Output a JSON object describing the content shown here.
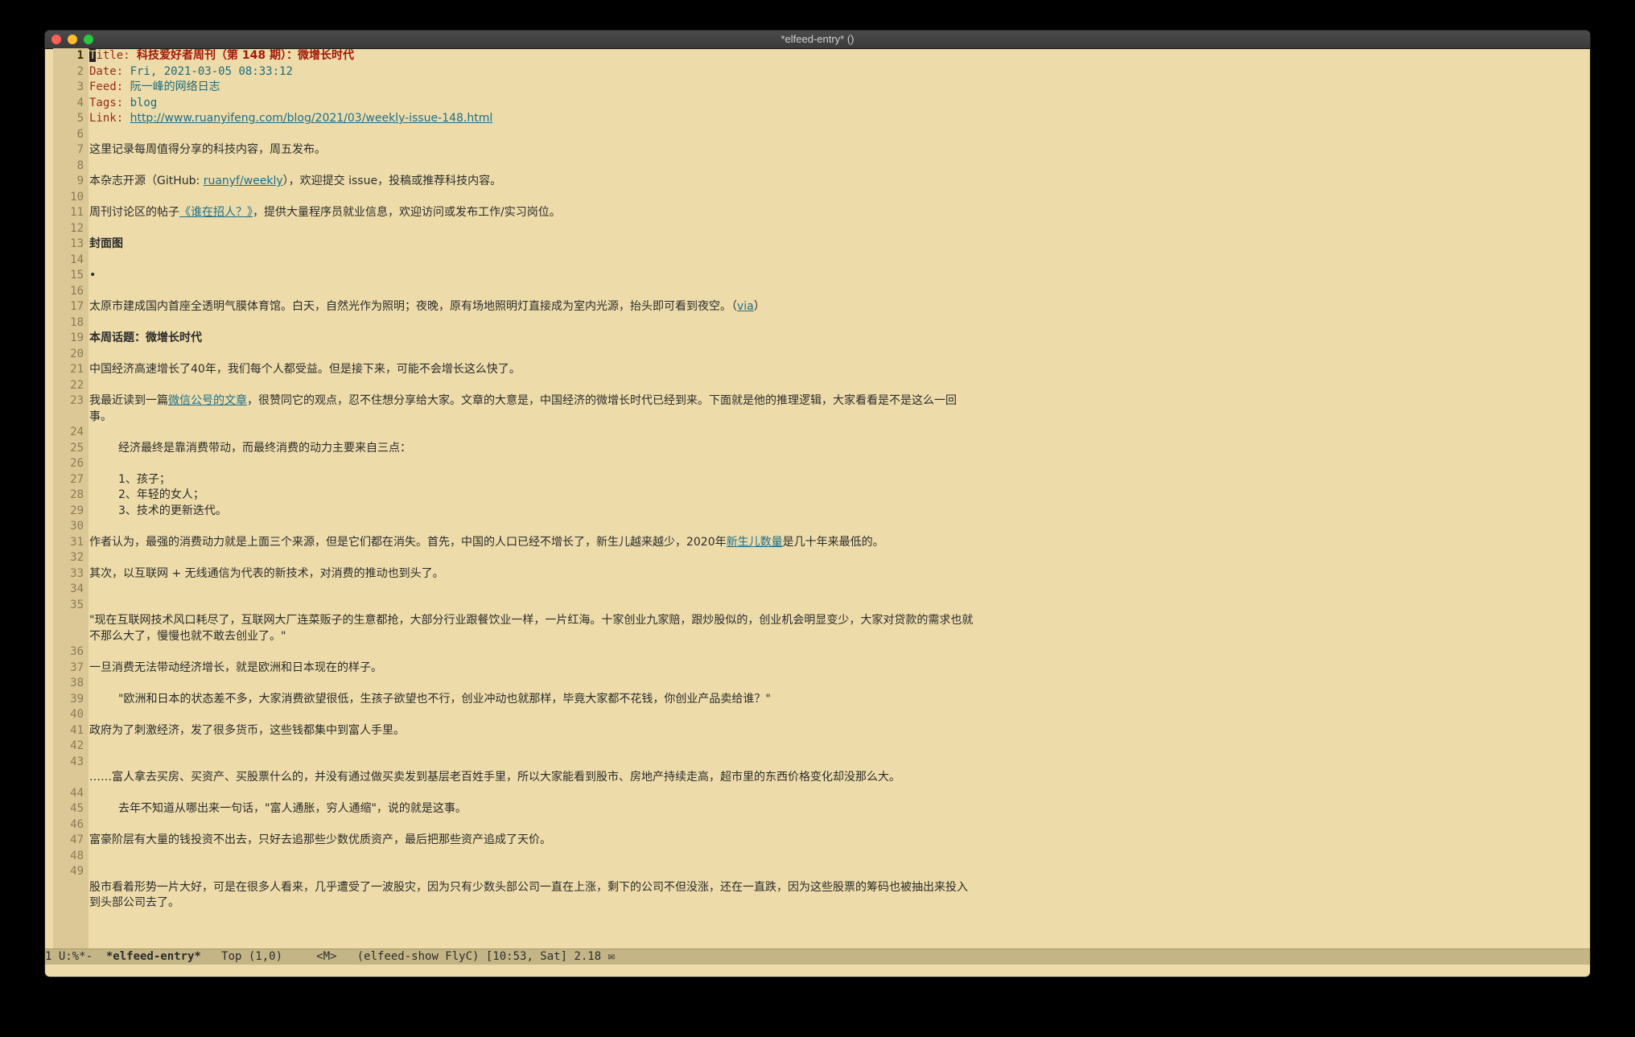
{
  "window": {
    "title": "*elfeed-entry* ()"
  },
  "lines": [
    {
      "n": "1",
      "key": "Title: ",
      "val": "科技爱好者周刊（第 148 期）：微增长时代",
      "cls": "hdr-title"
    },
    {
      "n": "2",
      "key": "Date: ",
      "val": "Fri, 2021-03-05 08:33:12",
      "cls": "hdr-val mono"
    },
    {
      "n": "3",
      "key": "Feed: ",
      "val": "阮一峰的网络日志",
      "cls": "hdr-val"
    },
    {
      "n": "4",
      "key": "Tags: ",
      "val": "blog",
      "cls": "hdr-val mono"
    },
    {
      "n": "5",
      "key": "Link: ",
      "val": "http://www.ruanyifeng.com/blog/2021/03/weekly-issue-148.html",
      "cls": "lnk"
    },
    {
      "n": "6"
    },
    {
      "n": "7",
      "text": "这里记录每周值得分享的科技内容，周五发布。"
    },
    {
      "n": "8"
    },
    {
      "n": "9",
      "text": "本杂志开源（GitHub: ",
      "link": "ruanyf/weekly",
      "after": "），欢迎提交 issue，投稿或推荐科技内容。"
    },
    {
      "n": "10"
    },
    {
      "n": "11",
      "text": "周刊讨论区的帖子",
      "link": "《谁在招人？》",
      "after": "，提供大量程序员就业信息，欢迎访问或发布工作/实习岗位。"
    },
    {
      "n": "12"
    },
    {
      "n": "13",
      "text": "封面图",
      "bold": true
    },
    {
      "n": "14"
    },
    {
      "n": "15",
      "text": "•"
    },
    {
      "n": "16"
    },
    {
      "n": "17",
      "text": "太原市建成国内首座全透明气膜体育馆。白天，自然光作为照明；夜晚，原有场地照明灯直接成为室内光源，抬头即可看到夜空。（",
      "link": "via",
      "after": "）"
    },
    {
      "n": "18"
    },
    {
      "n": "19",
      "text": "本周话题：微增长时代",
      "bold": true
    },
    {
      "n": "20"
    },
    {
      "n": "21",
      "text": "中国经济高速增长了40年，我们每个人都受益。但是接下来，可能不会增长这么快了。"
    },
    {
      "n": "22"
    },
    {
      "n": "23",
      "text": "我最近读到一篇",
      "link": "微信公号的文章",
      "after": "，很赞同它的观点，忍不住想分享给大家。文章的大意是，中国经济的微增长时代已经到来。下面就是他的推理逻辑，大家看看是不是这么一回事。"
    },
    {
      "n": "24"
    },
    {
      "n": "25",
      "text": "经济最终是靠消费带动，而最终消费的动力主要来自三点：",
      "quote": true
    },
    {
      "n": "26"
    },
    {
      "n": "27",
      "text": "1、孩子；",
      "quote": true
    },
    {
      "n": "28",
      "text": "2、年轻的女人；",
      "quote": true
    },
    {
      "n": "29",
      "text": "3、技术的更新迭代。",
      "quote": true
    },
    {
      "n": "30"
    },
    {
      "n": "31",
      "text": "作者认为，最强的消费动力就是上面三个来源，但是它们都在消失。首先，中国的人口已经不增长了，新生儿越来越少，2020年",
      "link": "新生儿数量",
      "after": "是几十年来最低的。"
    },
    {
      "n": "32"
    },
    {
      "n": "33",
      "text": "其次，以互联网 + 无线通信为代表的新技术，对消费的推动也到头了。"
    },
    {
      "n": "34"
    },
    {
      "n": "35",
      "text": "\n\"现在互联网技术风口耗尽了，互联网大厂连菜贩子的生意都抢，大部分行业跟餐饮业一样，一片红海。十家创业九家赔，跟炒股似的，创业机会明显变少，大家对贷款的需求也就不那么大了，慢慢也就不敢去创业了。\""
    },
    {
      "n": "36"
    },
    {
      "n": "37",
      "text": "一旦消费无法带动经济增长，就是欧洲和日本现在的样子。"
    },
    {
      "n": "38"
    },
    {
      "n": "39",
      "text": "\"欧洲和日本的状态差不多，大家消费欲望很低，生孩子欲望也不行，创业冲动也就那样，毕竟大家都不花钱，你创业产品卖给谁？\"",
      "quote": true
    },
    {
      "n": "40"
    },
    {
      "n": "41",
      "text": "政府为了刺激经济，发了很多货币，这些钱都集中到富人手里。"
    },
    {
      "n": "42"
    },
    {
      "n": "43",
      "text": "\n……富人拿去买房、买资产、买股票什么的，并没有通过做买卖发到基层老百姓手里，所以大家能看到股市、房地产持续走高，超市里的东西价格变化却没那么大。"
    },
    {
      "n": "44"
    },
    {
      "n": "45",
      "text": "去年不知道从哪出来一句话，\"富人通胀，穷人通缩\"，说的就是这事。",
      "quote": true
    },
    {
      "n": "46"
    },
    {
      "n": "47",
      "text": "富豪阶层有大量的钱投资不出去，只好去追那些少数优质资产，最后把那些资产追成了天价。"
    },
    {
      "n": "48"
    },
    {
      "n": "49",
      "text": "\n股市看着形势一片大好，可是在很多人看来，几乎遭受了一波股灾，因为只有少数头部公司一直在上涨，剩下的公司不但没涨，还在一直跌，因为这些股票的筹码也被抽出来投入到头部公司去了。"
    }
  ],
  "modeline": {
    "state": "1 U:%*-  ",
    "buffer": "*elfeed-entry*",
    "rest": "   Top (1,0)     <M>   (elfeed-show FlyC) [10:53, Sat] 2.18 ✉"
  }
}
